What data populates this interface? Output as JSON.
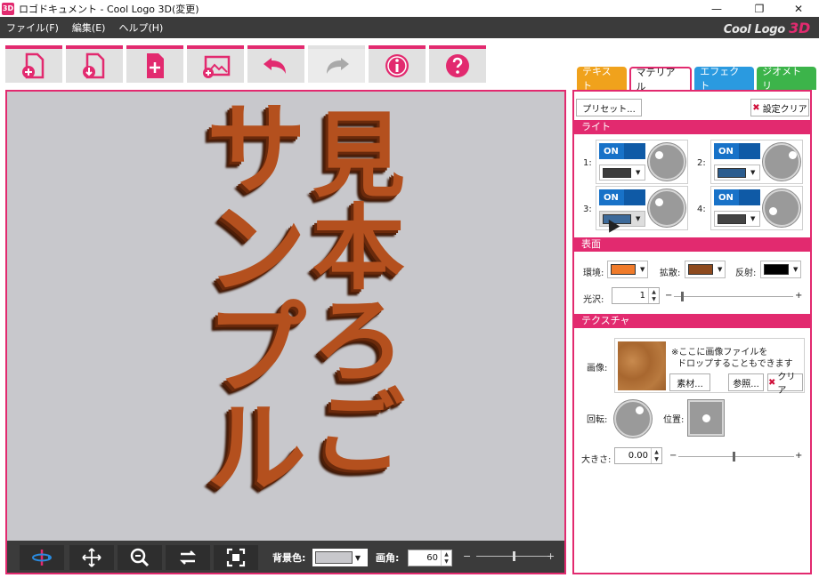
{
  "window": {
    "icon_text": "3D",
    "title": "ロゴドキュメント - Cool Logo 3D(変更)",
    "minimize": "—",
    "maximize": "❐",
    "close": "✕"
  },
  "menu": {
    "items": [
      "ファイル(F)",
      "編集(E)",
      "ヘルプ(H)"
    ],
    "brand_text": "Cool Logo ",
    "brand_accent": "3D"
  },
  "toolbar": {
    "buttons": [
      {
        "name": "new-document",
        "icon": "new-doc-icon",
        "enabled": true
      },
      {
        "name": "open-document",
        "icon": "open-doc-icon",
        "enabled": true
      },
      {
        "name": "add-text",
        "icon": "add-page-icon",
        "enabled": true
      },
      {
        "name": "add-image",
        "icon": "add-image-icon",
        "enabled": true
      },
      {
        "name": "undo",
        "icon": "undo-icon",
        "enabled": true
      },
      {
        "name": "redo",
        "icon": "redo-icon",
        "enabled": false
      },
      {
        "name": "info",
        "icon": "info-icon",
        "enabled": true
      },
      {
        "name": "help",
        "icon": "help-icon",
        "enabled": true
      }
    ],
    "accent": "#e22a6f"
  },
  "canvas": {
    "background": "#c8c8cc",
    "logo_columns": [
      {
        "chars": [
          "サ",
          "ン",
          "プ",
          "ル"
        ]
      },
      {
        "chars": [
          "見",
          "本",
          "ろ",
          "ご"
        ]
      }
    ],
    "logo_color": "#b4501e"
  },
  "viewport_bar": {
    "bg_label": "背景色:",
    "bg_color": "#c8c8cc",
    "fov_label": "画角:",
    "fov_value": "60",
    "minus": "−",
    "plus": "+"
  },
  "panel": {
    "tabs": [
      {
        "label": "テキスト",
        "color": "#f0a21c",
        "active": false
      },
      {
        "label": "マテリアル",
        "color": "#e22a6f",
        "active": true
      },
      {
        "label": "エフェクト",
        "color": "#2a9ae0",
        "active": false
      },
      {
        "label": "ジオメトリ",
        "color": "#3cb44a",
        "active": false
      }
    ],
    "preset_label": "プリセット...",
    "clear_settings_label": "設定クリア",
    "light_section": "ライト",
    "lights": [
      {
        "num": "1:",
        "state": "ON",
        "color": "#3b3b3b"
      },
      {
        "num": "2:",
        "state": "ON",
        "color": "#2b5c8e"
      },
      {
        "num": "3:",
        "state": "ON",
        "color": "#3d6a9a"
      },
      {
        "num": "4:",
        "state": "ON",
        "color": "#444444"
      }
    ],
    "surface_section": "表面",
    "ambient_label": "環境:",
    "ambient_color": "#f07b2a",
    "diffuse_label": "拡散:",
    "diffuse_color": "#8e4a1e",
    "reflect_label": "反射:",
    "reflect_color": "#000000",
    "gloss_label": "光沢:",
    "gloss_value": "1",
    "texture_section": "テクスチャ",
    "image_label": "画像:",
    "drop_hint_1": "※ここに画像ファイルを",
    "drop_hint_2": "ドロップすることもできます",
    "material_button": "素材...",
    "browse_button": "参照...",
    "clear_button": "クリア",
    "rotate_label": "回転:",
    "position_label": "位置:",
    "size_label": "大きさ:",
    "size_value": "0.00",
    "minus": "−",
    "plus": "+"
  }
}
